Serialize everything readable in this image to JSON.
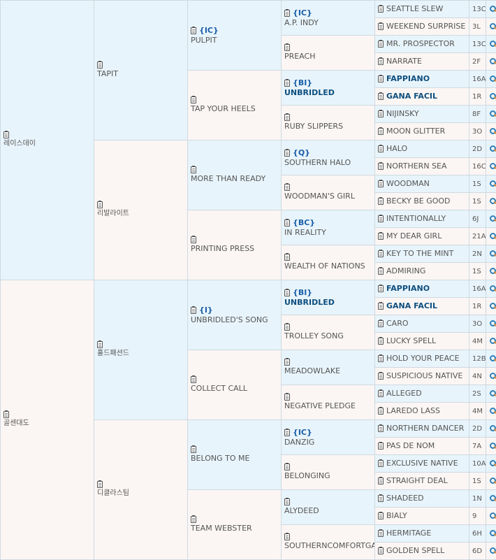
{
  "gen1": [
    {
      "name": "레이스데이"
    },
    {
      "name": "골센대도"
    }
  ],
  "gen2": [
    {
      "name": "TAPIT"
    },
    {
      "name": "리발라이트"
    },
    {
      "name": "홀드패션드"
    },
    {
      "name": "디클라스팀"
    }
  ],
  "gen3": [
    {
      "tag": "{IC}",
      "name": "PULPIT"
    },
    {
      "tag": "",
      "name": "TAP YOUR HEELS"
    },
    {
      "tag": "",
      "name": "MORE THAN READY"
    },
    {
      "tag": "",
      "name": "PRINTING PRESS"
    },
    {
      "tag": "{I}",
      "name": "UNBRIDLED'S SONG"
    },
    {
      "tag": "",
      "name": "COLLECT CALL"
    },
    {
      "tag": "",
      "name": "BELONG TO ME"
    },
    {
      "tag": "",
      "name": "TEAM WEBSTER"
    }
  ],
  "gen4": [
    {
      "tag": "{IC}",
      "name": "A.P. INDY"
    },
    {
      "tag": "",
      "name": "PREACH"
    },
    {
      "tag": "{BI}",
      "name": "UNBRIDLED"
    },
    {
      "tag": "",
      "name": "RUBY SLIPPERS"
    },
    {
      "tag": "{Q}",
      "name": "SOUTHERN HALO"
    },
    {
      "tag": "",
      "name": "WOODMAN'S GIRL"
    },
    {
      "tag": "{BC}",
      "name": "IN REALITY"
    },
    {
      "tag": "",
      "name": "WEALTH OF NATIONS"
    },
    {
      "tag": "{BI}",
      "name": "UNBRIDLED"
    },
    {
      "tag": "",
      "name": "TROLLEY SONG"
    },
    {
      "tag": "",
      "name": "MEADOWLAKE"
    },
    {
      "tag": "",
      "name": "NEGATIVE PLEDGE"
    },
    {
      "tag": "{IC}",
      "name": "DANZIG"
    },
    {
      "tag": "",
      "name": "BELONGING"
    },
    {
      "tag": "",
      "name": "ALYDEED"
    },
    {
      "tag": "",
      "name": "SOUTHERNCOMFORTGAL"
    }
  ],
  "gen5": [
    {
      "name": "SEATTLE SLEW",
      "code": "13C"
    },
    {
      "name": "WEEKEND SURPRISE",
      "code": "3L"
    },
    {
      "name": "MR. PROSPECTOR",
      "code": "13C"
    },
    {
      "name": "NARRATE",
      "code": "2F"
    },
    {
      "name": "FAPPIANO",
      "code": "16A"
    },
    {
      "name": "GANA FACIL",
      "code": "1R"
    },
    {
      "name": "NIJINSKY",
      "code": "8F"
    },
    {
      "name": "MOON GLITTER",
      "code": "3O"
    },
    {
      "name": "HALO",
      "code": "2D"
    },
    {
      "name": "NORTHERN SEA",
      "code": "16C"
    },
    {
      "name": "WOODMAN",
      "code": "1S"
    },
    {
      "name": "BECKY BE GOOD",
      "code": "1S"
    },
    {
      "name": "INTENTIONALLY",
      "code": "6J"
    },
    {
      "name": "MY DEAR GIRL",
      "code": "21A"
    },
    {
      "name": "KEY TO THE MINT",
      "code": "2N"
    },
    {
      "name": "ADMIRING",
      "code": "1S"
    },
    {
      "name": "FAPPIANO",
      "code": "16A"
    },
    {
      "name": "GANA FACIL",
      "code": "1R"
    },
    {
      "name": "CARO",
      "code": "3O"
    },
    {
      "name": "LUCKY SPELL",
      "code": "4M"
    },
    {
      "name": "HOLD YOUR PEACE",
      "code": "12B"
    },
    {
      "name": "SUSPICIOUS NATIVE",
      "code": "4N"
    },
    {
      "name": "ALLEGED",
      "code": "2S"
    },
    {
      "name": "LAREDO LASS",
      "code": "4M"
    },
    {
      "name": "NORTHERN DANCER",
      "code": "2D"
    },
    {
      "name": "PAS DE NOM",
      "code": "7A"
    },
    {
      "name": "EXCLUSIVE NATIVE",
      "code": "10A"
    },
    {
      "name": "STRAIGHT DEAL",
      "code": "1S"
    },
    {
      "name": "SHADEED",
      "code": "1N"
    },
    {
      "name": "BIALY",
      "code": "9"
    },
    {
      "name": "HERMITAGE",
      "code": "6H"
    },
    {
      "name": "GOLDEN SPELL",
      "code": "6D"
    }
  ],
  "colors": {
    "blue_cell": "#e8f4fb",
    "pink_cell": "#fbf6f4",
    "border": "#cfd9e0",
    "bold_name": "#0e4f7f",
    "tag": "#1a5fa8"
  },
  "icons": {
    "details": "clipboard-icon",
    "search": "magnifier-icon"
  }
}
